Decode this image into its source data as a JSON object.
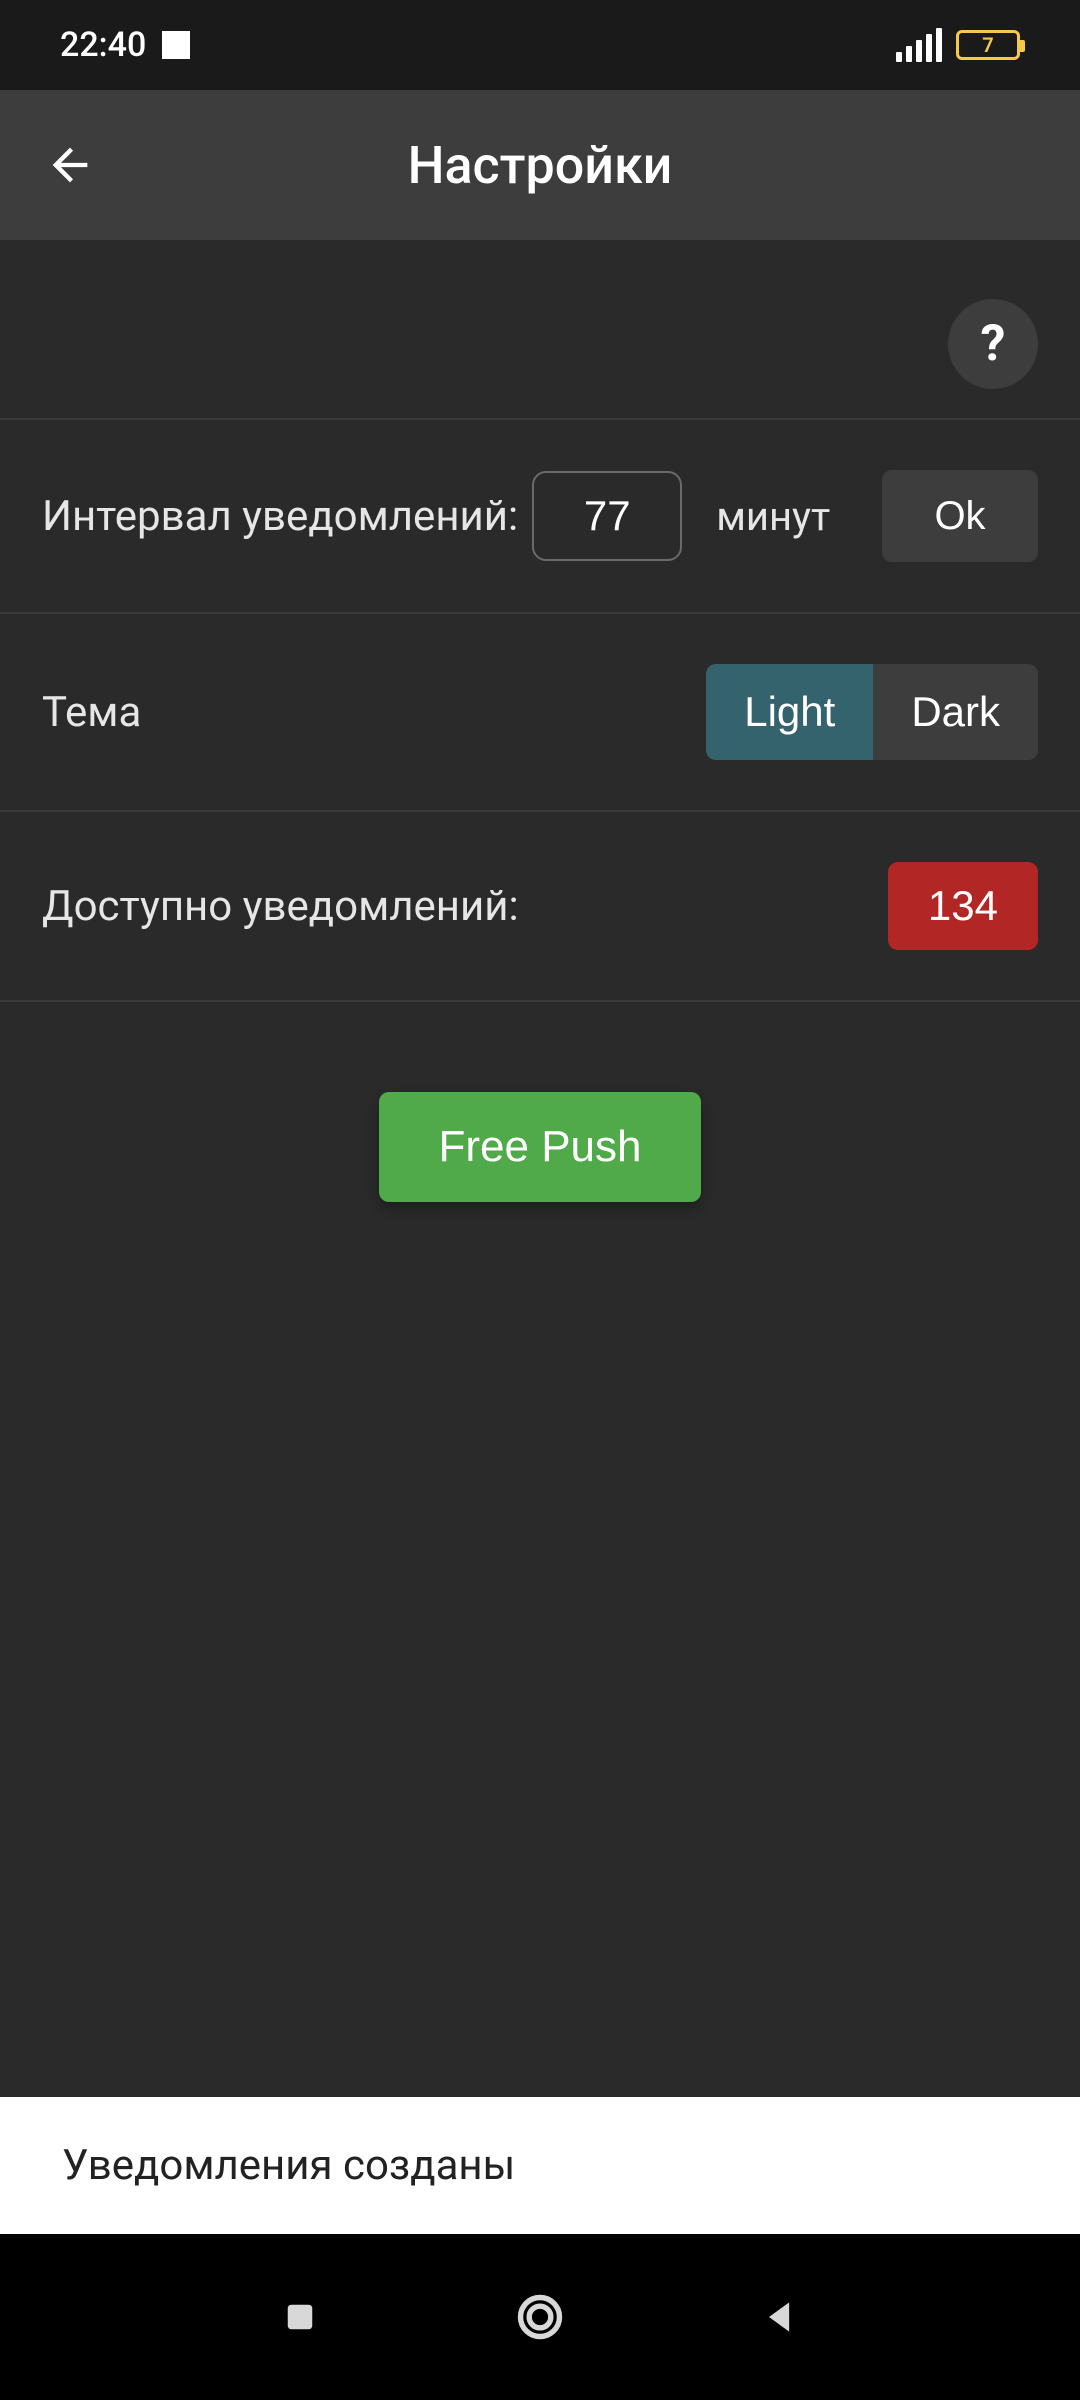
{
  "status": {
    "time": "22:40",
    "battery": "7"
  },
  "header": {
    "title": "Настройки"
  },
  "help": {
    "icon_label": "?"
  },
  "interval": {
    "label": "Интервал уведомлений:",
    "value": "77",
    "unit": "минут",
    "ok": "Ok"
  },
  "theme": {
    "label": "Тема",
    "light": "Light",
    "dark": "Dark",
    "selected": "light"
  },
  "available": {
    "label": "Доступно уведомлений:",
    "count": "134"
  },
  "freepush": {
    "label": "Free Push"
  },
  "toast": {
    "message": "Уведомления созданы"
  }
}
